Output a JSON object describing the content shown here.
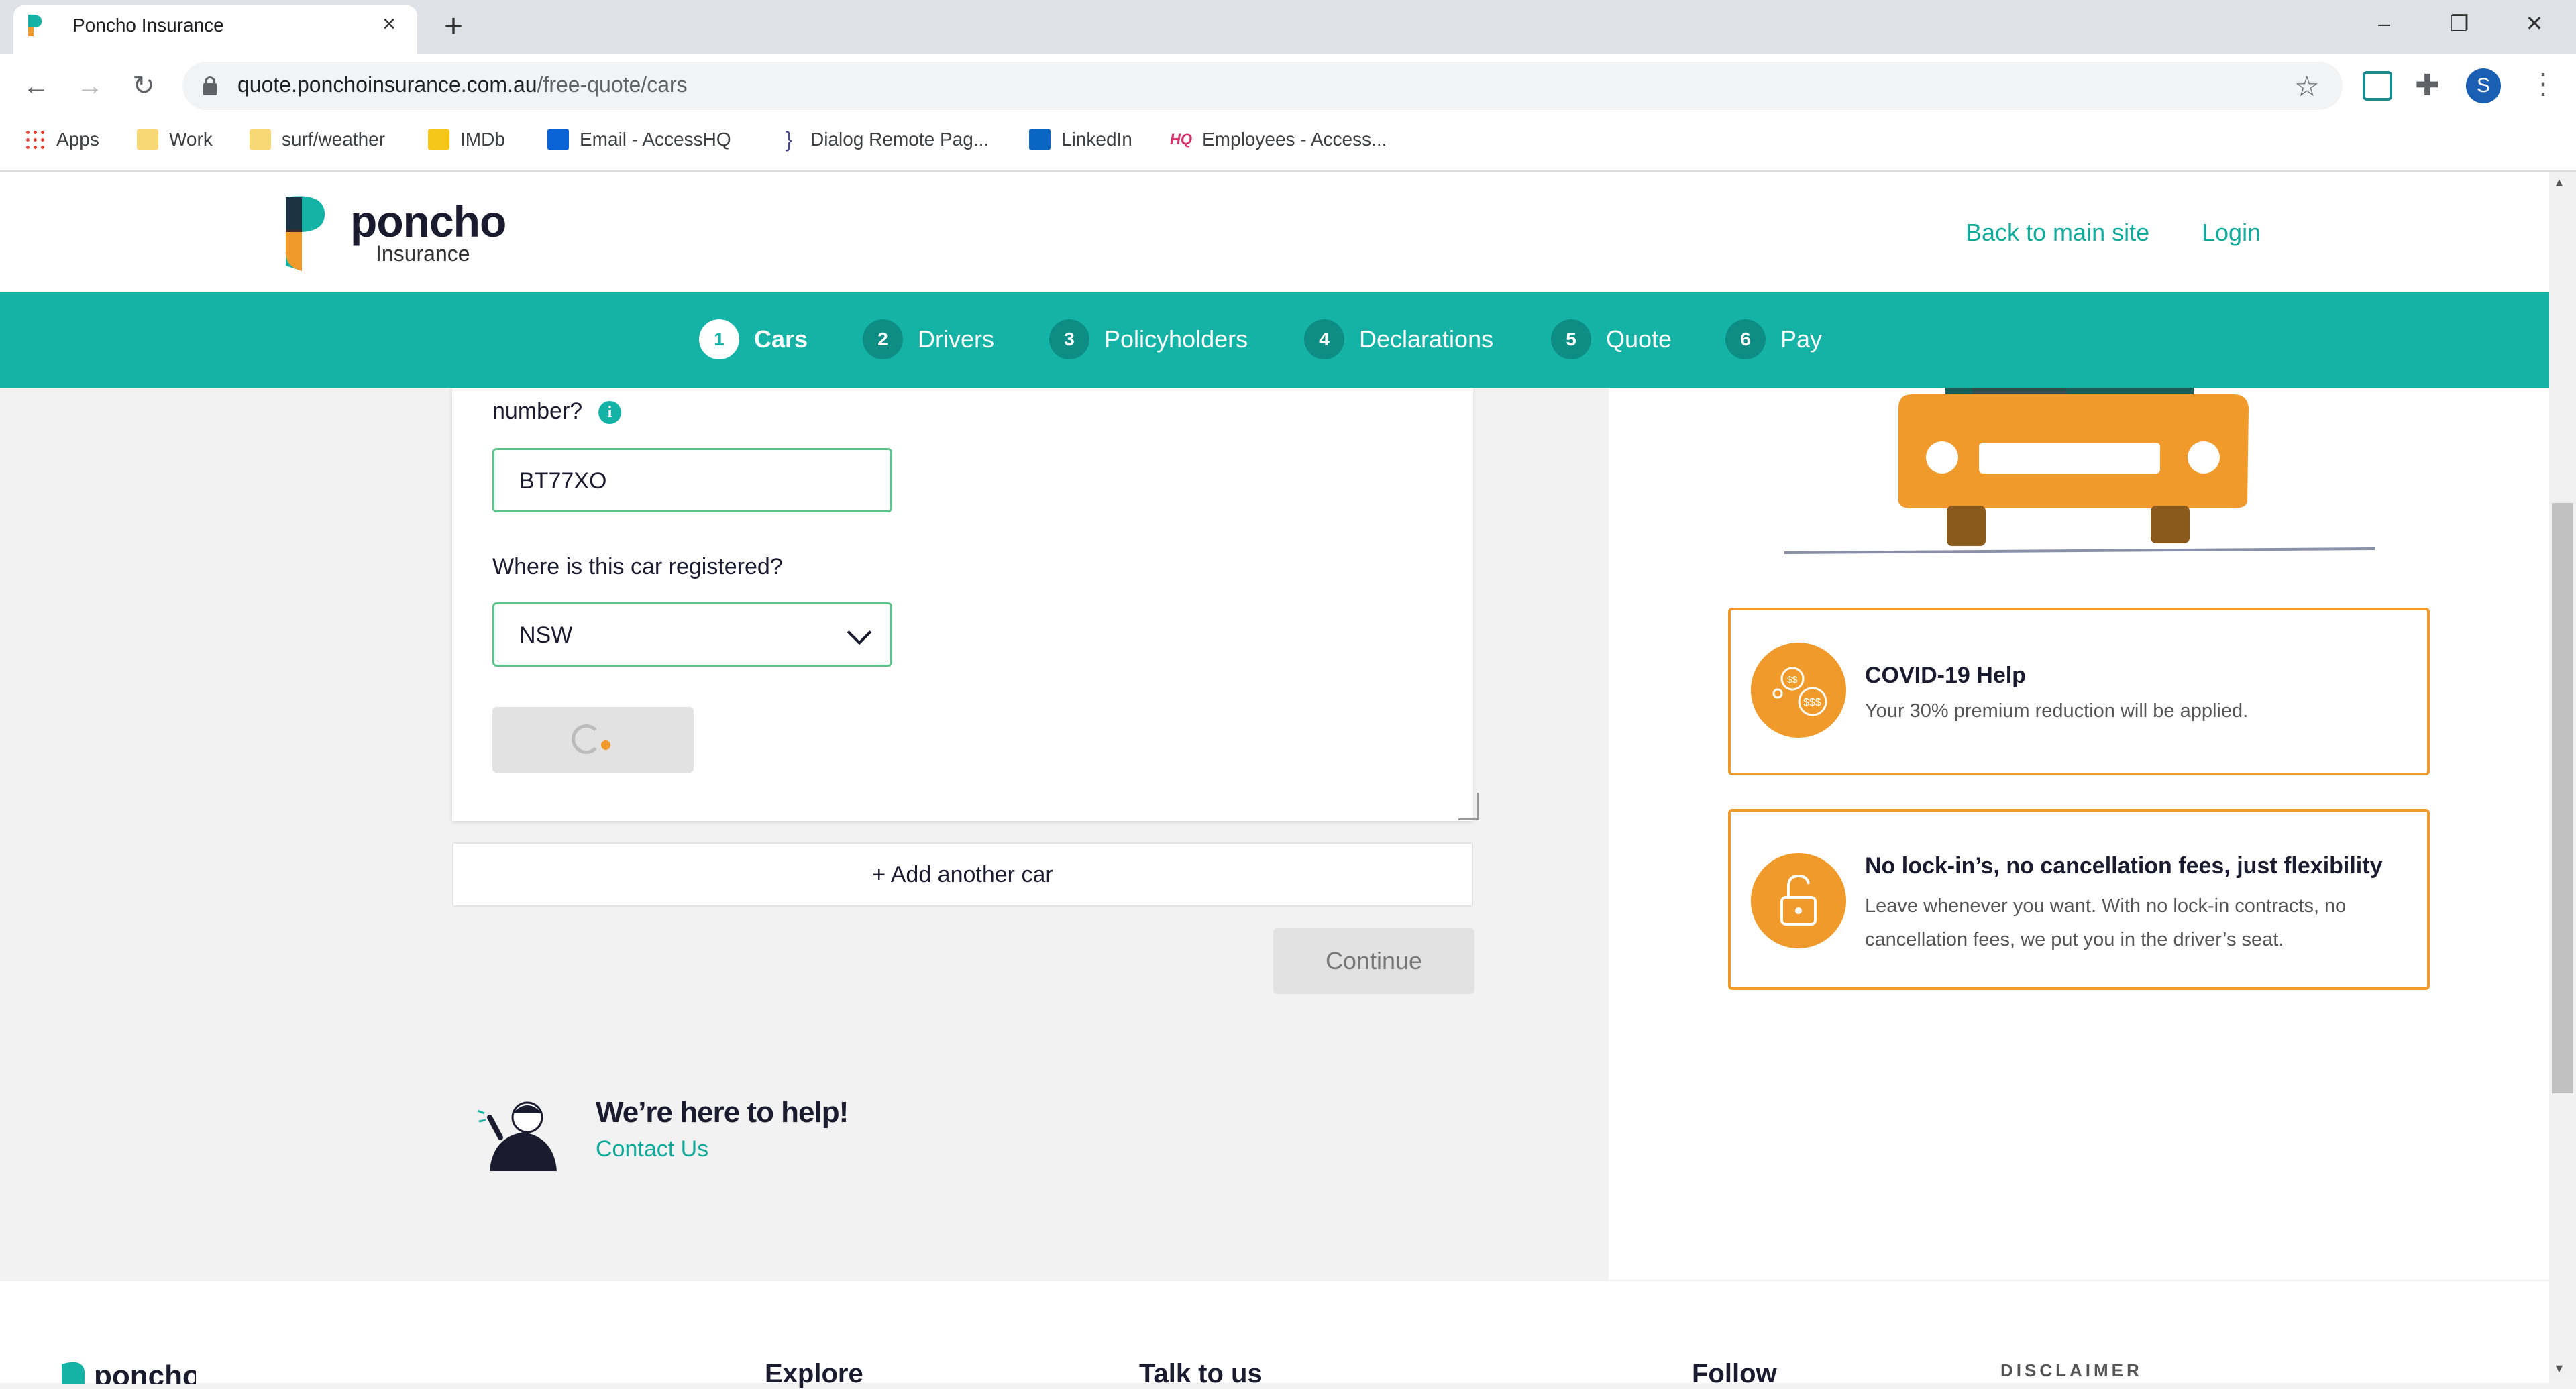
{
  "browser": {
    "tab_title": "Poncho Insurance",
    "new_tab": "+",
    "url_host": "quote.ponchoinsurance.com.au",
    "url_path": "/free-quote/cars",
    "avatar_initial": "S",
    "bookmarks": [
      {
        "label": "Apps",
        "icon": "apps-grid-icon",
        "color": "#e94235"
      },
      {
        "label": "Work",
        "icon": "folder-icon",
        "color": "#f8d775"
      },
      {
        "label": "surf/weather",
        "icon": "folder-icon",
        "color": "#f8d775"
      },
      {
        "label": "IMDb",
        "icon": "imdb-icon",
        "color": "#f5c518"
      },
      {
        "label": "Email - AccessHQ",
        "icon": "outlook-icon",
        "color": "#0a64d6"
      },
      {
        "label": "Dialog Remote Pag...",
        "icon": "dialog-icon",
        "color": "#4a4a8a"
      },
      {
        "label": "LinkedIn",
        "icon": "linkedin-icon",
        "color": "#0a66c2"
      },
      {
        "label": "Employees - Access...",
        "icon": "hq-icon",
        "color": "#d6336c"
      }
    ]
  },
  "header": {
    "logo_text": "poncho",
    "logo_sub": "Insurance",
    "back_link": "Back to main site",
    "login_link": "Login"
  },
  "steps": [
    {
      "num": "1",
      "label": "Cars",
      "active": true
    },
    {
      "num": "2",
      "label": "Drivers",
      "active": false
    },
    {
      "num": "3",
      "label": "Policyholders",
      "active": false
    },
    {
      "num": "4",
      "label": "Declarations",
      "active": false
    },
    {
      "num": "5",
      "label": "Quote",
      "active": false
    },
    {
      "num": "6",
      "label": "Pay",
      "active": false
    }
  ],
  "form": {
    "reg_question_partial": "number?",
    "info_glyph": "i",
    "plate_value": "BT77XO",
    "state_question": "Where is this car registered?",
    "state_value": "NSW",
    "add_car": "+ Add another car",
    "continue": "Continue"
  },
  "help": {
    "title": "We’re here to help!",
    "contact": "Contact Us"
  },
  "info_boxes": {
    "covid_title": "COVID-19 Help",
    "covid_text": "Your 30% premium reduction will be applied.",
    "lock_title": "No lock-in’s, no cancellation fees, just flexibility",
    "lock_text": "Leave whenever you want. With no lock-in contracts, no cancellation fees, we put you in the driver’s seat."
  },
  "footer": {
    "explore": "Explore",
    "talk": "Talk to us",
    "follow": "Follow",
    "disclaimer": "DISCLAIMER"
  },
  "colors": {
    "teal": "#15b3a6",
    "orange": "#f09a2b",
    "navy": "#1b1b2f"
  }
}
